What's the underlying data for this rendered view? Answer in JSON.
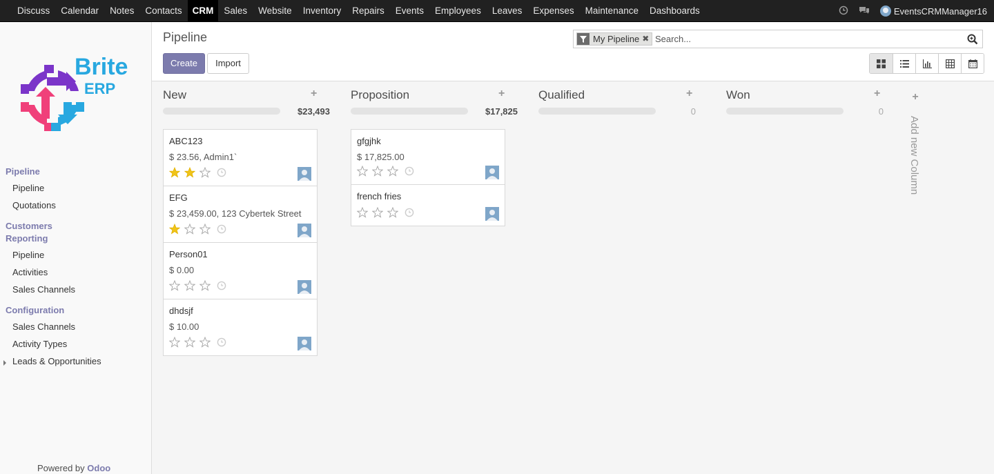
{
  "topbar": {
    "menu": [
      "Discuss",
      "Calendar",
      "Notes",
      "Contacts",
      "CRM",
      "Sales",
      "Website",
      "Inventory",
      "Repairs",
      "Events",
      "Employees",
      "Leaves",
      "Expenses",
      "Maintenance",
      "Dashboards"
    ],
    "active": "CRM",
    "user": "EventsCRMManager16"
  },
  "logo": {
    "line1": "Brite",
    "line2": "ERP"
  },
  "sidebar": {
    "sections": [
      {
        "title": "Pipeline",
        "items": [
          "Pipeline",
          "Quotations"
        ]
      },
      {
        "title": "Customers",
        "items": []
      },
      {
        "title": "Reporting",
        "items": [
          "Pipeline",
          "Activities",
          "Sales Channels"
        ]
      },
      {
        "title": "Configuration",
        "items": [
          "Sales Channels",
          "Activity Types",
          "Leads & Opportunities"
        ]
      }
    ],
    "powered_by": "Powered by",
    "powered_brand": "Odoo"
  },
  "control": {
    "breadcrumb": "Pipeline",
    "create_label": "Create",
    "import_label": "Import",
    "facet_label": "My Pipeline",
    "search_placeholder": "Search..."
  },
  "kanban": {
    "columns": [
      {
        "title": "New",
        "sum": "$23,493",
        "cards": [
          {
            "name": "ABC123",
            "amount": "$ 23.56, Admin1`",
            "stars": 2
          },
          {
            "name": "EFG",
            "amount": "$ 23,459.00, 123 Cybertek Street",
            "stars": 1
          },
          {
            "name": "Person01",
            "amount": "$ 0.00",
            "stars": 0
          },
          {
            "name": "dhdsjf",
            "amount": "$ 10.00",
            "stars": 0
          }
        ]
      },
      {
        "title": "Proposition",
        "sum": "$17,825",
        "cards": [
          {
            "name": "gfgjhk",
            "amount": "$ 17,825.00",
            "stars": 0
          },
          {
            "name": "french fries",
            "amount": "",
            "stars": 0
          }
        ]
      },
      {
        "title": "Qualified",
        "sum": "0",
        "cards": []
      },
      {
        "title": "Won",
        "sum": "0",
        "cards": []
      }
    ],
    "add_column_label": "Add new Column"
  },
  "colors": {
    "primary": "#7c7bad",
    "topbar": "#212121",
    "star_on": "#f0c419",
    "star_off": "#bbbbbb"
  }
}
